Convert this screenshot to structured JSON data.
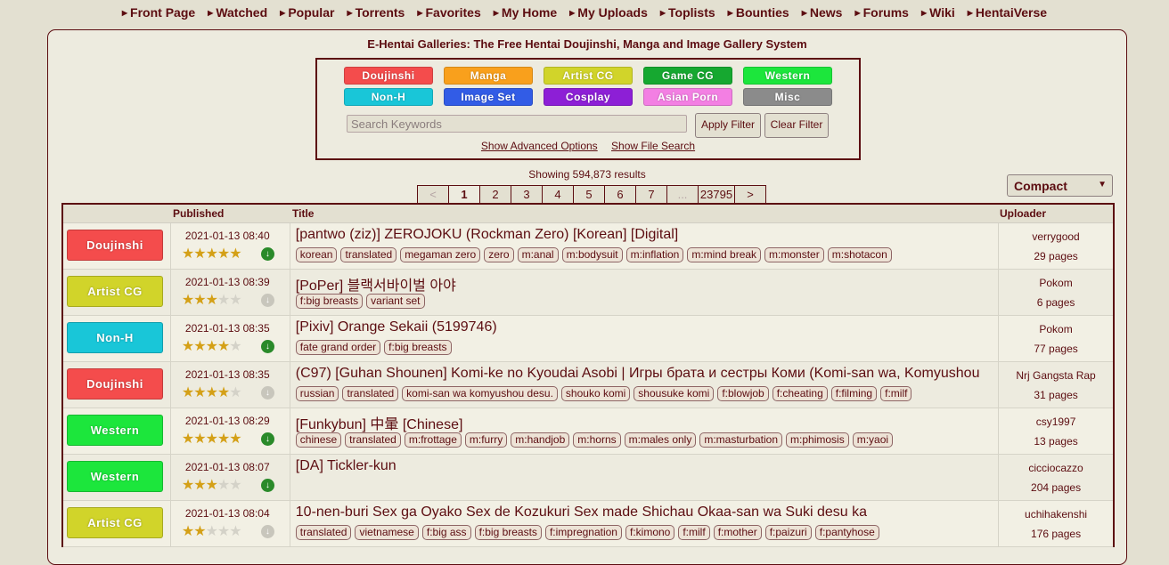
{
  "nav": [
    "Front Page",
    "Watched",
    "Popular",
    "Torrents",
    "Favorites",
    "My Home",
    "My Uploads",
    "Toplists",
    "Bounties",
    "News",
    "Forums",
    "Wiki",
    "HentaiVerse"
  ],
  "site_title": "E-Hentai Galleries: The Free Hentai Doujinshi, Manga and Image Gallery System",
  "categories": [
    {
      "label": "Doujinshi",
      "color": "#f44c4c"
    },
    {
      "label": "Manga",
      "color": "#f9a01c"
    },
    {
      "label": "Artist CG",
      "color": "#d1d42a"
    },
    {
      "label": "Game CG",
      "color": "#16a830"
    },
    {
      "label": "Western",
      "color": "#1ce63c"
    },
    {
      "label": "Non-H",
      "color": "#19c6d8"
    },
    {
      "label": "Image Set",
      "color": "#325ce6"
    },
    {
      "label": "Cosplay",
      "color": "#8d1fd6"
    },
    {
      "label": "Asian Porn",
      "color": "#f37fe3"
    },
    {
      "label": "Misc",
      "color": "#8b8b8b"
    }
  ],
  "search": {
    "placeholder": "Search Keywords",
    "apply_label": "Apply Filter",
    "clear_label": "Clear Filter",
    "advanced_link": "Show Advanced Options",
    "file_search_link": "Show File Search"
  },
  "showing_text": "Showing 594,873 results",
  "pager": [
    "<",
    "1",
    "2",
    "3",
    "4",
    "5",
    "6",
    "7",
    "...",
    "23795",
    ">"
  ],
  "display_mode": "Compact",
  "table_headers": {
    "published": "Published",
    "title": "Title",
    "uploader": "Uploader"
  },
  "galleries": [
    {
      "category": "Doujinshi",
      "cat_color": "#f44c4c",
      "published": "2021-01-13 08:40",
      "rating": 4.5,
      "torrent": true,
      "title": "[pantwo (ziz)] ZEROJOKU (Rockman Zero) [Korean] [Digital]",
      "tags": [
        "korean",
        "translated",
        "megaman zero",
        "zero",
        "m:anal",
        "m:bodysuit",
        "m:inflation",
        "m:mind break",
        "m:monster",
        "m:shotacon"
      ],
      "uploader": "verrygood",
      "pages": "29 pages"
    },
    {
      "category": "Artist CG",
      "cat_color": "#d1d42a",
      "published": "2021-01-13 08:39",
      "rating": 2.5,
      "torrent": false,
      "title": "[PoPer] 블랙서바이벌 아야",
      "tags": [
        "f:big breasts",
        "variant set"
      ],
      "uploader": "Pokom",
      "pages": "6 pages"
    },
    {
      "category": "Non-H",
      "cat_color": "#19c6d8",
      "published": "2021-01-13 08:35",
      "rating": 4,
      "torrent": true,
      "title": "[Pixiv] Orange Sekaii (5199746)",
      "tags": [
        "fate grand order",
        "f:big breasts"
      ],
      "uploader": "Pokom",
      "pages": "77 pages"
    },
    {
      "category": "Doujinshi",
      "cat_color": "#f44c4c",
      "published": "2021-01-13 08:35",
      "rating": 4,
      "torrent": false,
      "title": "(C97) [Guhan Shounen] Komi-ke no Kyoudai Asobi | Игры брата и сестры Коми (Komi-san wa, Komyushou",
      "tags": [
        "russian",
        "translated",
        "komi-san wa komyushou desu.",
        "shouko komi",
        "shousuke komi",
        "f:blowjob",
        "f:cheating",
        "f:filming",
        "f:milf"
      ],
      "uploader": "Nrj Gangsta Rap",
      "pages": "31 pages"
    },
    {
      "category": "Western",
      "cat_color": "#1ce63c",
      "published": "2021-01-13 08:29",
      "rating": 4.5,
      "torrent": true,
      "title": "[Funkybun] 中暈 [Chinese]",
      "tags": [
        "chinese",
        "translated",
        "m:frottage",
        "m:furry",
        "m:handjob",
        "m:horns",
        "m:males only",
        "m:masturbation",
        "m:phimosis",
        "m:yaoi"
      ],
      "uploader": "csy1997",
      "pages": "13 pages"
    },
    {
      "category": "Western",
      "cat_color": "#1ce63c",
      "published": "2021-01-13 08:07",
      "rating": 2.5,
      "torrent": true,
      "title": "[DA] Tickler-kun",
      "tags": [],
      "uploader": "cicciocazzo",
      "pages": "204 pages"
    },
    {
      "category": "Artist CG",
      "cat_color": "#d1d42a",
      "published": "2021-01-13 08:04",
      "rating": 1.5,
      "torrent": false,
      "title": "10-nen-buri Sex ga Oyako Sex de Kozukuri Sex made Shichau Okaa-san wa Suki desu ka",
      "tags": [
        "translated",
        "vietnamese",
        "f:big ass",
        "f:big breasts",
        "f:impregnation",
        "f:kimono",
        "f:milf",
        "f:mother",
        "f:paizuri",
        "f:pantyhose"
      ],
      "uploader": "uchihakenshi",
      "pages": "176 pages"
    }
  ]
}
